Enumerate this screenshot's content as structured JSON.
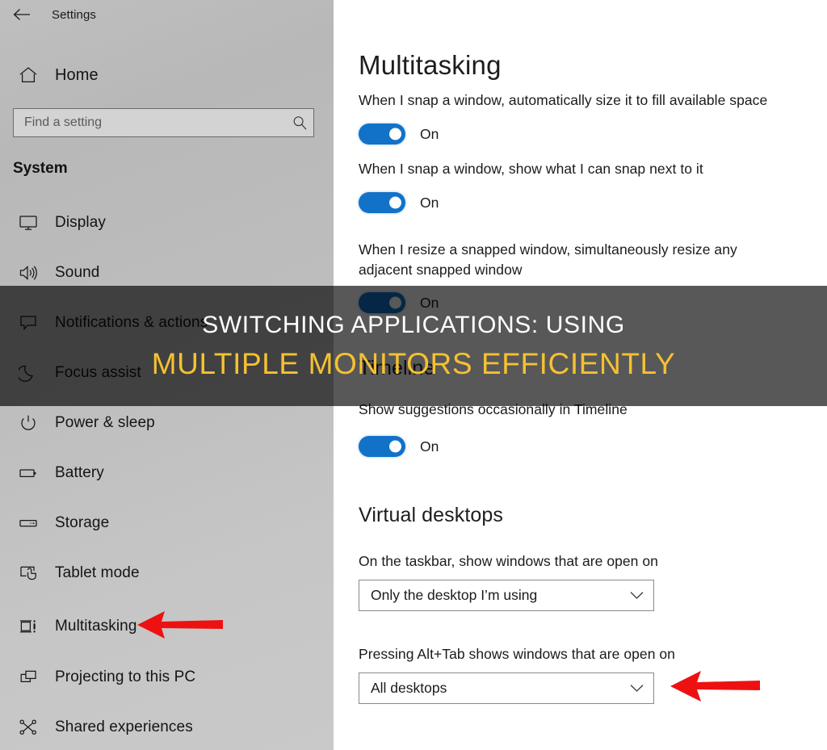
{
  "app": {
    "title": "Settings",
    "back_icon": "back-arrow-icon"
  },
  "sidebar": {
    "home": {
      "label": "Home",
      "icon": "home-icon"
    },
    "search": {
      "placeholder": "Find a setting",
      "value": "",
      "icon": "search-icon"
    },
    "section_title": "System",
    "items": [
      {
        "label": "Display",
        "icon": "monitor-icon"
      },
      {
        "label": "Sound",
        "icon": "speaker-icon"
      },
      {
        "label": "Notifications & actions",
        "icon": "chat-bubble-icon"
      },
      {
        "label": "Focus assist",
        "icon": "moon-icon"
      },
      {
        "label": "Power & sleep",
        "icon": "power-icon"
      },
      {
        "label": "Battery",
        "icon": "battery-icon"
      },
      {
        "label": "Storage",
        "icon": "drive-icon"
      },
      {
        "label": "Tablet mode",
        "icon": "tablet-touch-icon"
      },
      {
        "label": "Multitasking",
        "icon": "multitasking-icon"
      },
      {
        "label": "Projecting to this PC",
        "icon": "project-screen-icon"
      },
      {
        "label": "Shared experiences",
        "icon": "share-nodes-icon"
      }
    ]
  },
  "main": {
    "heading": "Multitasking",
    "snap_settings": [
      {
        "label": "When I snap a window, automatically size it to fill available space",
        "state": "On"
      },
      {
        "label": "When I snap a window, show what I can snap next to it",
        "state": "On"
      },
      {
        "label": "When I resize a snapped window, simultaneously resize any adjacent snapped window",
        "state": "On"
      }
    ],
    "timeline": {
      "heading": "Timeline",
      "setting": {
        "label": "Show suggestions occasionally in Timeline",
        "state": "On"
      }
    },
    "virtual_desktops": {
      "heading": "Virtual desktops",
      "taskbar": {
        "label": "On the taskbar, show windows that are open on",
        "value": "Only the desktop I’m using",
        "options": [
          "Only the desktop I’m using",
          "All desktops"
        ]
      },
      "alt_tab": {
        "label": "Pressing Alt+Tab shows windows that are open on",
        "value": "All desktops",
        "options": [
          "Only the desktop I’m using",
          "All desktops"
        ]
      }
    }
  },
  "overlay": {
    "line1": "SWITCHING APPLICATIONS: USING",
    "line2": "MULTIPLE MONITORS EFFICIENTLY",
    "line1_color": "#ffffff",
    "line2_color": "#f5c132",
    "band_color": "#585858"
  },
  "annotations": {
    "arrow_color": "#ee1111",
    "arrows": [
      {
        "name": "arrow-pointing-multitasking",
        "target": "Multitasking"
      },
      {
        "name": "arrow-pointing-alt-tab-dropdown",
        "target": "All desktops"
      }
    ]
  },
  "colors": {
    "toggle_on": "#1172c8",
    "sidebar_bg": "#bdbdbd",
    "content_bg": "#ffffff"
  }
}
